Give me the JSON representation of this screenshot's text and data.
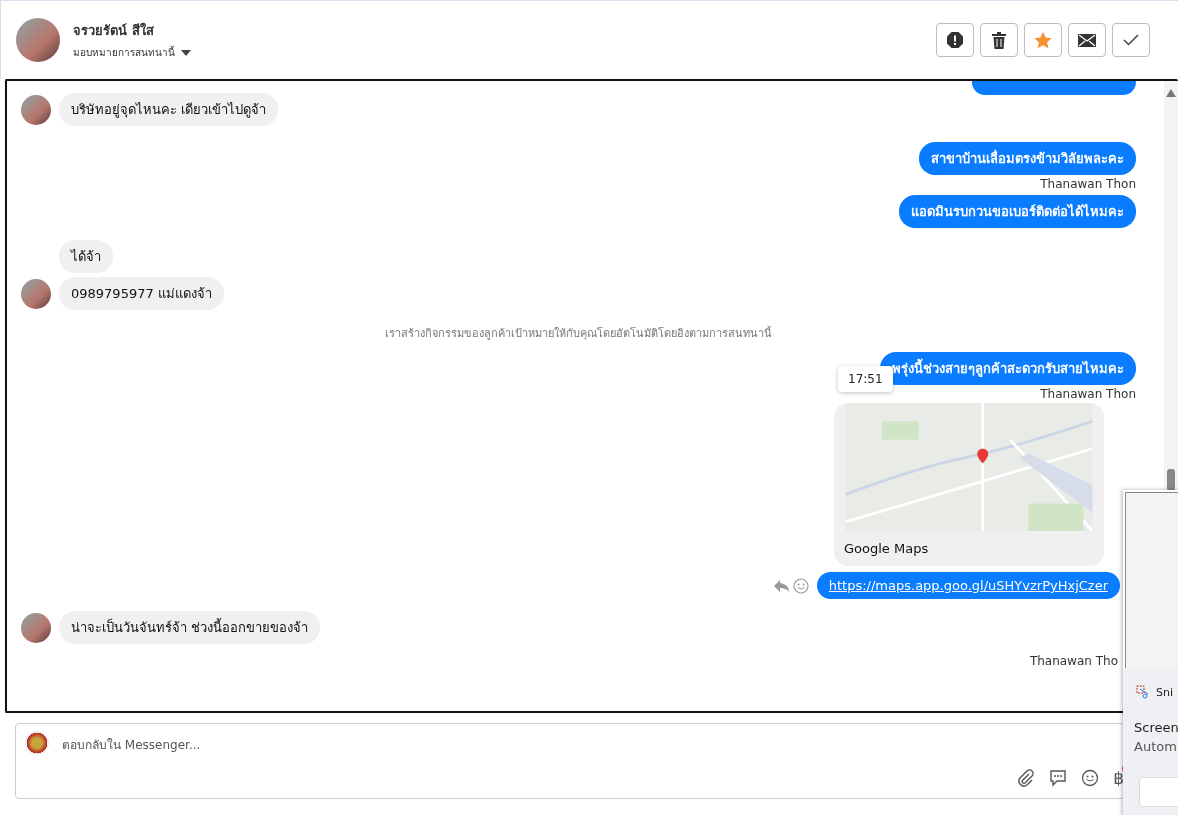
{
  "header": {
    "contact_name": "จรวยรัตน์ สีใส",
    "assign_label": "มอบหมายการสนทนานี้",
    "actions": [
      {
        "kind": "report"
      },
      {
        "kind": "delete"
      },
      {
        "kind": "star",
        "on": true
      },
      {
        "kind": "mail"
      },
      {
        "kind": "done"
      }
    ]
  },
  "messages": [
    {
      "kind": "incoming",
      "avatar": true,
      "text": "บริษัทอยู่จุดไหนคะ เดียวเข้าไปดูจ้า"
    },
    {
      "kind": "outgoing",
      "text": "สาขาบ้านเลื่อมตรงข้ามวิลัยพละคะ",
      "sender": "Thanawan Thon"
    },
    {
      "kind": "outgoing",
      "text": "แอดมินรบกวนขอเบอร์ติดต่อได้ไหมคะ"
    },
    {
      "kind": "incoming",
      "avatar": false,
      "text": "ได้จ้า"
    },
    {
      "kind": "incoming",
      "avatar": true,
      "text": "0989795977 แม่แดงจ้า"
    },
    {
      "kind": "notice",
      "text": "เราสร้างกิจกรรมของลูกค้าเป้าหมายให้กับคุณโดยอัตโนมัติโดยอิงตามการสนทนานี้"
    },
    {
      "kind": "outgoing",
      "text": "พรุ่งนี้ช่วงสายๆลูกค้าสะดวกรับสายไหมคะ",
      "sender": "Thanawan Thon",
      "tooltip": "17:51"
    },
    {
      "kind": "map",
      "title": "Google Maps"
    },
    {
      "kind": "link",
      "text": "https://maps.app.goo.gl/uSHYvzrPyHxjCzer"
    },
    {
      "kind": "incoming",
      "avatar": true,
      "text": "น่าจะเป็นวันจันทร์จ้า ช่วงนี้ออกขายของจ้า"
    },
    {
      "kind": "sender",
      "text": "Thanawan Tho"
    }
  ],
  "composer": {
    "placeholder": "ตอบกลับใน Messenger...",
    "currency": "฿"
  },
  "notification": {
    "app": "Sni",
    "title": "Screen",
    "body": "Autom"
  }
}
